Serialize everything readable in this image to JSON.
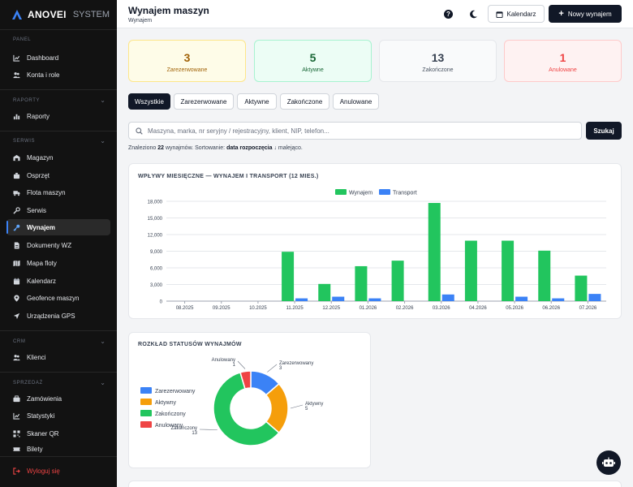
{
  "brand": {
    "name": "ANOVEI",
    "suffix": "SYSTEM"
  },
  "sidebar": {
    "sections": [
      {
        "title": "PANEL"
      },
      {
        "title": "RAPORTY"
      },
      {
        "title": "SERWIS"
      },
      {
        "title": "CRM"
      },
      {
        "title": "SPRZEDAŻ"
      }
    ],
    "items": [
      {
        "label": "Dashboard",
        "icon": "chart-icon"
      },
      {
        "label": "Konta i role",
        "icon": "users-icon"
      },
      {
        "label": "Raporty",
        "icon": "report-icon"
      },
      {
        "label": "Magazyn",
        "icon": "warehouse-icon"
      },
      {
        "label": "Osprzęt",
        "icon": "attachment-icon"
      },
      {
        "label": "Flota maszyn",
        "icon": "truck-icon"
      },
      {
        "label": "Serwis",
        "icon": "wrench-icon"
      },
      {
        "label": "Wynajem",
        "icon": "key-icon"
      },
      {
        "label": "Dokumenty WZ",
        "icon": "document-icon"
      },
      {
        "label": "Mapa floty",
        "icon": "map-icon"
      },
      {
        "label": "Kalendarz",
        "icon": "calendar-icon"
      },
      {
        "label": "Geofence maszyn",
        "icon": "geofence-icon"
      },
      {
        "label": "Urządzenia GPS",
        "icon": "gps-icon"
      },
      {
        "label": "Klienci",
        "icon": "clients-icon"
      },
      {
        "label": "Zamówienia",
        "icon": "orders-icon"
      },
      {
        "label": "Statystyki",
        "icon": "stats-icon"
      },
      {
        "label": "Skaner QR",
        "icon": "qr-icon"
      },
      {
        "label": "Bilety",
        "icon": "ticket-icon"
      }
    ],
    "logout": "Wyloguj się"
  },
  "header": {
    "title": "Wynajem maszyn",
    "breadcrumb": "Wynajem",
    "calendar_label": "Kalendarz",
    "new_label": "Nowy wynajem"
  },
  "stats": [
    {
      "value": "3",
      "label": "Zarezerwowane"
    },
    {
      "value": "5",
      "label": "Aktywne"
    },
    {
      "value": "13",
      "label": "Zakończone"
    },
    {
      "value": "1",
      "label": "Anulowane"
    }
  ],
  "filters": [
    "Wszystkie",
    "Zarezerwowane",
    "Aktywne",
    "Zakończone",
    "Anulowane"
  ],
  "active_filter": "Wszystkie",
  "search": {
    "placeholder": "Maszyna, marka, nr seryjny / rejestracyjny, klient, NIP, telefon...",
    "button": "Szukaj"
  },
  "results": {
    "prefix": "Znaleziono",
    "count": "22",
    "middle": "wynajmów. Sortowanie:",
    "sort_field": "data rozpoczęcia",
    "sort_arrow": "↓",
    "suffix": "malejąco."
  },
  "colors": {
    "rental": "#22c55e",
    "transport": "#3b82f6",
    "reserved": "#3b82f6",
    "active": "#f59e0b",
    "finished": "#22c55e",
    "cancelled": "#ef4444"
  },
  "chart_data": [
    {
      "type": "bar",
      "title": "WPŁYWY MIESIĘCZNE — WYNAJEM I TRANSPORT (12 MIES.)",
      "categories": [
        "08.2025",
        "09.2025",
        "10.2025",
        "11.2025",
        "12.2025",
        "01.2026",
        "02.2026",
        "03.2026",
        "04.2026",
        "05.2026",
        "06.2026",
        "07.2026"
      ],
      "series": [
        {
          "name": "Wynajem",
          "values": [
            0,
            0,
            0,
            8900,
            3100,
            6300,
            7300,
            17700,
            10900,
            10900,
            9100,
            4600
          ]
        },
        {
          "name": "Transport",
          "values": [
            0,
            0,
            0,
            500,
            800,
            500,
            0,
            1200,
            0,
            800,
            500,
            1300
          ]
        }
      ],
      "yticks": [
        "0",
        "3,000",
        "6,000",
        "9,000",
        "12,000",
        "15,000",
        "18,000"
      ],
      "ylim": [
        0,
        18000
      ],
      "grid": true,
      "legend": "top-center"
    },
    {
      "type": "pie",
      "title": "ROZKŁAD STATUSÓW WYNAJMÓW",
      "slices": [
        {
          "label": "Zarezerwowany",
          "value": 3
        },
        {
          "label": "Aktywny",
          "value": 5
        },
        {
          "label": "Zakończony",
          "value": 13
        },
        {
          "label": "Anulowany",
          "value": 1
        }
      ],
      "legend": "left"
    }
  ]
}
